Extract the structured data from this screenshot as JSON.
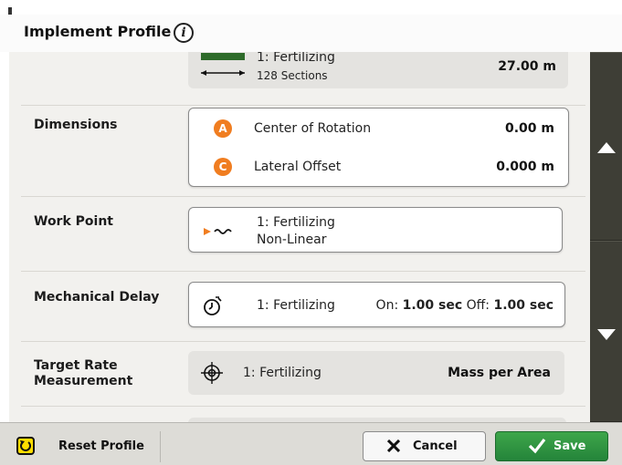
{
  "header": {
    "title": "Implement Profile",
    "info_symbol": "i"
  },
  "rows": {
    "top_card": {
      "implement": "1: Fertilizing",
      "sections": "128 Sections",
      "width": "27.00 m",
      "icon": "implement-width-icon"
    },
    "dimensions": {
      "label": "Dimensions",
      "items": [
        {
          "badge": "A",
          "label": "Center of Rotation",
          "value": "0.00 m"
        },
        {
          "badge": "C",
          "label": "Lateral Offset",
          "value": "0.000 m"
        }
      ]
    },
    "work_point": {
      "label": "Work Point",
      "implement": "1: Fertilizing",
      "mode": "Non-Linear",
      "icon": "work-point-icon"
    },
    "mechanical_delay": {
      "label": "Mechanical Delay",
      "implement": "1: Fertilizing",
      "on_prefix": "On:",
      "on_value": "1.00 sec",
      "off_prefix": "Off:",
      "off_value": "1.00 sec",
      "icon": "timer-icon"
    },
    "target_rate": {
      "label_line1": "Target Rate",
      "label_line2": "Measurement",
      "implement": "1: Fertilizing",
      "value": "Mass per Area",
      "icon": "crosshair-icon"
    }
  },
  "footer": {
    "reset_label": "Reset Profile",
    "cancel_label": "Cancel",
    "save_label": "Save"
  },
  "colors": {
    "accent_orange": "#f07d20",
    "save_green": "#2e9a43",
    "reset_yellow": "#ffde00",
    "scrollbar": "#3a3a33"
  }
}
